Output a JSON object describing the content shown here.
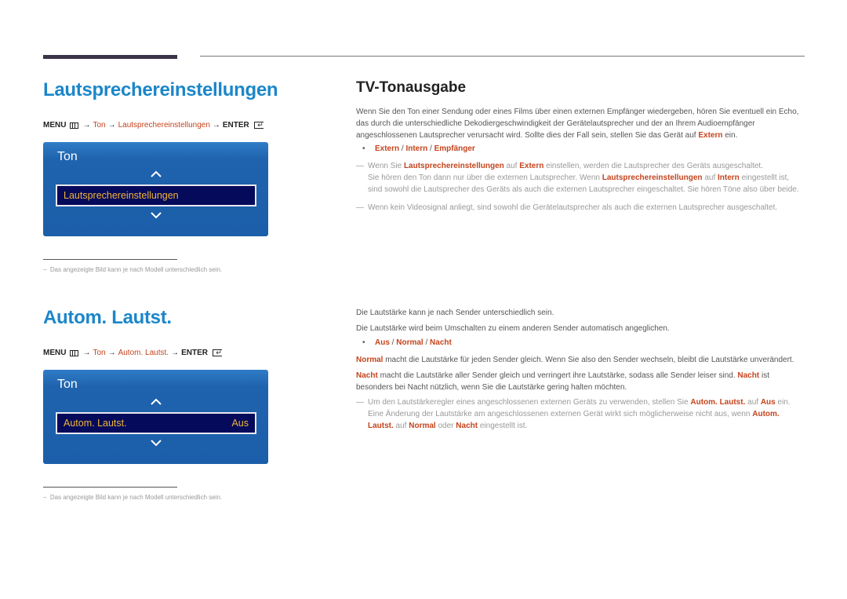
{
  "sections": [
    {
      "title": "Lautsprechereinstellungen",
      "path": {
        "menu": "MENU",
        "arrow": "→",
        "crumb1": "Ton",
        "crumb2": "Lautsprechereinstellungen",
        "enter": "ENTER"
      },
      "tv_menu": {
        "title": "Ton",
        "selected_label": "Lautsprechereinstellungen",
        "selected_value": ""
      },
      "footnote": "Das angezeigte Bild kann je nach Modell unterschiedlich sein."
    },
    {
      "title": "Autom. Lautst.",
      "path": {
        "menu": "MENU",
        "arrow": "→",
        "crumb1": "Ton",
        "crumb2": "Autom. Lautst.",
        "enter": "ENTER"
      },
      "tv_menu": {
        "title": "Ton",
        "selected_label": "Autom. Lautst.",
        "selected_value": "Aus"
      },
      "footnote": "Das angezeigte Bild kann je nach Modell unterschiedlich sein."
    }
  ],
  "right1": {
    "heading": "TV-Tonausgabe",
    "intro_pre": "Wenn Sie den Ton einer Sendung oder eines Films über einen externen Empfänger wiedergeben, hören Sie eventuell ein Echo, das durch die unterschiedliche Dekodiergeschwindigkeit der Gerätelautsprecher und der an Ihrem Audioempfänger angeschlossenen Lautsprecher verursacht wird. Sollte dies der Fall sein, stellen Sie das Gerät auf ",
    "intro_hl": "Extern",
    "intro_post": " ein.",
    "options": [
      "Extern",
      "Intern",
      "Empfänger"
    ],
    "note1": {
      "a": "Wenn Sie ",
      "b": "Lautsprechereinstellungen",
      "c": " auf ",
      "d": "Extern",
      "e": " einstellen, werden die Lautsprecher des Geräts ausgeschaltet.",
      "f": "Sie hören den Ton dann nur über die externen Lautsprecher. Wenn ",
      "g": "Lautsprechereinstellungen",
      "h": " auf ",
      "i": "Intern",
      "j": " eingestellt ist, sind sowohl die Lautsprecher des Geräts als auch die externen Lautsprecher eingeschaltet. Sie hören Töne also über beide."
    },
    "note2": "Wenn kein Videosignal anliegt, sind sowohl die Gerätelautsprecher als auch die externen Lautsprecher ausgeschaltet."
  },
  "right2": {
    "line1": "Die Lautstärke kann je nach Sender unterschiedlich sein.",
    "line2": "Die Lautstärke wird beim Umschalten zu einem anderen Sender automatisch angeglichen.",
    "options": [
      "Aus",
      "Normal",
      "Nacht"
    ],
    "normal": {
      "hl": "Normal",
      "text": " macht die Lautstärke für jeden Sender gleich. Wenn Sie also den Sender wechseln, bleibt die Lautstärke unverändert."
    },
    "nacht": {
      "hl": "Nacht",
      "text": " macht die Lautstärke aller Sender gleich und verringert ihre Lautstärke, sodass alle Sender leiser sind. ",
      "hl2": "Nacht",
      "text2": " ist besonders bei Nacht nützlich, wenn Sie die Lautstärke gering halten möchten."
    },
    "note": {
      "a": "Um den Lautstärkeregler eines angeschlossenen externen Geräts zu verwenden, stellen Sie ",
      "b": "Autom. Lautst.",
      "c": " auf ",
      "d": "Aus",
      "e": " ein. Eine Änderung der Lautstärke am angeschlossenen externen Gerät wirkt sich möglicherweise nicht aus, wenn ",
      "f": "Autom. Lautst.",
      "g": " auf ",
      "h": "Normal",
      "i": " oder ",
      "j": "Nacht",
      "k": " eingestellt ist."
    }
  },
  "symbols": {
    "dash": "—",
    "bullet": "•",
    "slash": " / ",
    "footnote_dash": "–"
  },
  "colors": {
    "title_blue": "#1b86c9",
    "highlight_red": "#c4441d",
    "tv_blue": "#1b5ea9",
    "tv_selection": "#050a5a",
    "tv_selection_text": "#f1b63a"
  }
}
